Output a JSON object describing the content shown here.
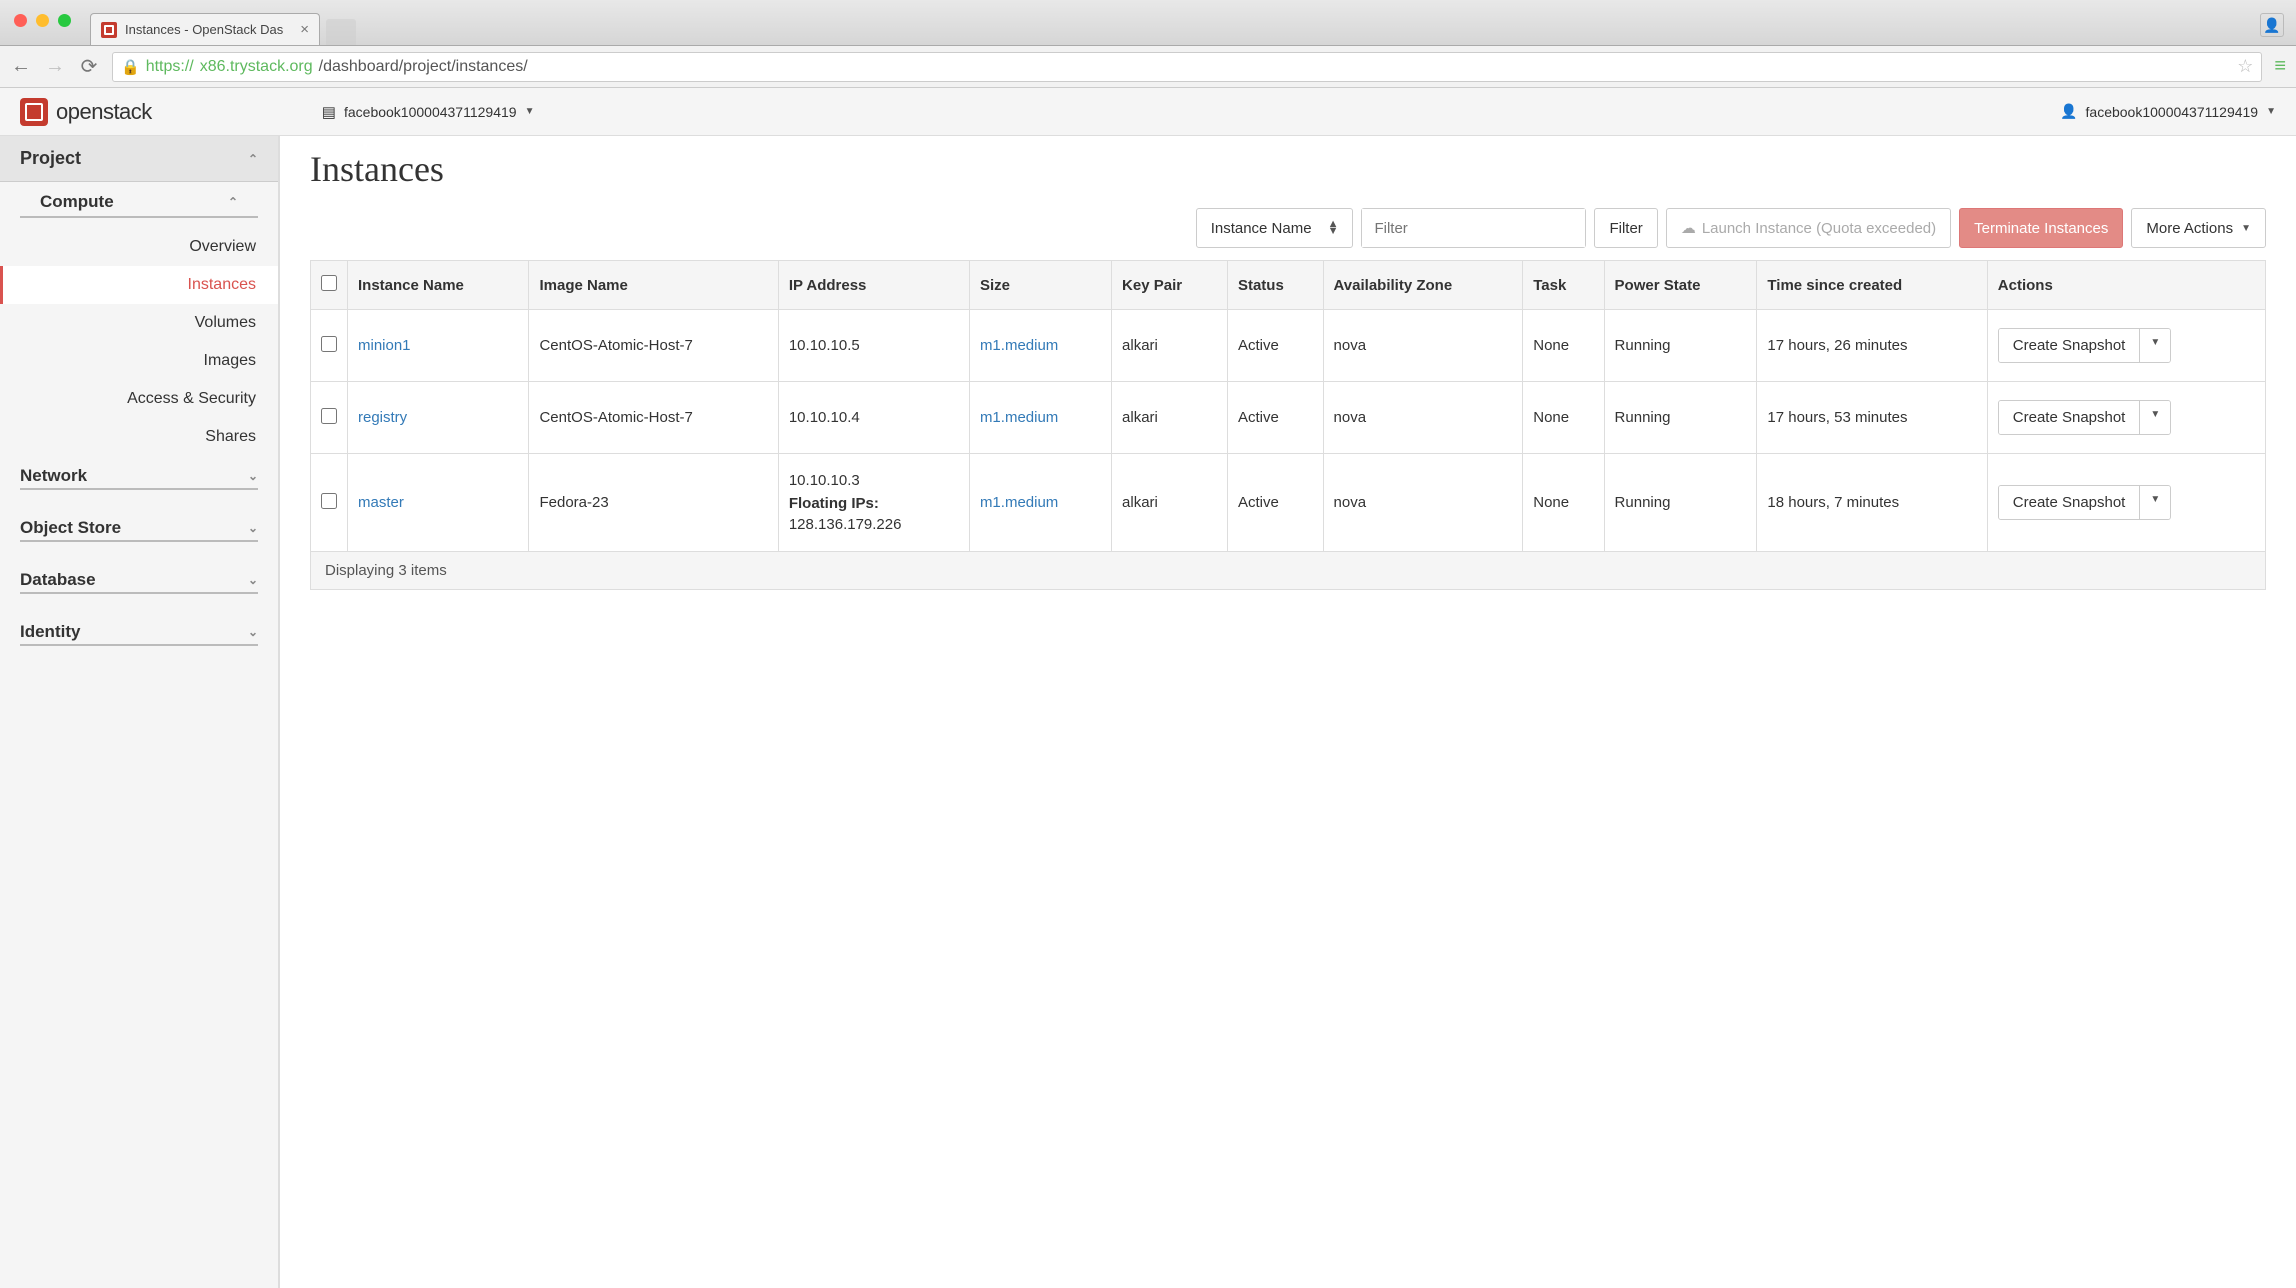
{
  "browser": {
    "tab_title": "Instances - OpenStack Das",
    "url_proto": "https://",
    "url_host": "x86.trystack.org",
    "url_path": "/dashboard/project/instances/"
  },
  "header": {
    "brand": "openstack",
    "project_name": "facebook100004371129419",
    "user_name": "facebook100004371129419"
  },
  "sidebar": {
    "project": "Project",
    "compute": "Compute",
    "items": {
      "overview": "Overview",
      "instances": "Instances",
      "volumes": "Volumes",
      "images": "Images",
      "access": "Access & Security",
      "shares": "Shares"
    },
    "network": "Network",
    "object_store": "Object Store",
    "database": "Database",
    "identity": "Identity"
  },
  "page": {
    "title": "Instances",
    "filter_selector": "Instance Name",
    "filter_placeholder": "Filter",
    "filter_btn": "Filter",
    "launch_btn": "Launch Instance (Quota exceeded)",
    "terminate_btn": "Terminate Instances",
    "more_actions": "More Actions",
    "footer": "Displaying 3 items"
  },
  "columns": {
    "instance_name": "Instance Name",
    "image_name": "Image Name",
    "ip": "IP Address",
    "size": "Size",
    "key_pair": "Key Pair",
    "status": "Status",
    "az": "Availability Zone",
    "task": "Task",
    "power": "Power State",
    "time": "Time since created",
    "actions": "Actions"
  },
  "rows": [
    {
      "name": "minion1",
      "image": "CentOS-Atomic-Host-7",
      "ip": "10.10.10.5",
      "floating_label": "",
      "floating_ip": "",
      "size": "m1.medium",
      "key": "alkari",
      "status": "Active",
      "az": "nova",
      "task": "None",
      "power": "Running",
      "time": "17 hours, 26 minutes",
      "action": "Create Snapshot"
    },
    {
      "name": "registry",
      "image": "CentOS-Atomic-Host-7",
      "ip": "10.10.10.4",
      "floating_label": "",
      "floating_ip": "",
      "size": "m1.medium",
      "key": "alkari",
      "status": "Active",
      "az": "nova",
      "task": "None",
      "power": "Running",
      "time": "17 hours, 53 minutes",
      "action": "Create Snapshot"
    },
    {
      "name": "master",
      "image": "Fedora-23",
      "ip": "10.10.10.3",
      "floating_label": "Floating IPs:",
      "floating_ip": "128.136.179.226",
      "size": "m1.medium",
      "key": "alkari",
      "status": "Active",
      "az": "nova",
      "task": "None",
      "power": "Running",
      "time": "18 hours, 7 minutes",
      "action": "Create Snapshot"
    }
  ]
}
